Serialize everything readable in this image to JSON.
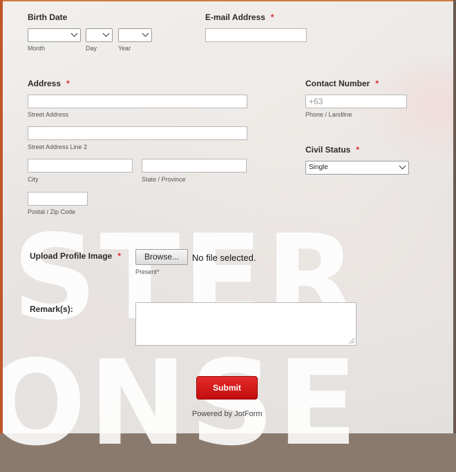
{
  "form": {
    "birth_date": {
      "label": "Birth Date",
      "month_sub": "Month",
      "day_sub": "Day",
      "year_sub": "Year"
    },
    "email": {
      "label": "E-mail Address",
      "required_mark": "*",
      "value": ""
    },
    "address": {
      "label": "Address",
      "required_mark": "*",
      "street_sub": "Street Address",
      "street2_sub": "Street Address Line 2",
      "city_sub": "City",
      "state_sub": "State / Province",
      "zip_sub": "Postal / Zip Code"
    },
    "contact": {
      "label": "Contact Number",
      "required_mark": "*",
      "placeholder": "+63",
      "sub": "Phone / Landline"
    },
    "civil_status": {
      "label": "Civil Status",
      "required_mark": "*",
      "selected": "Single"
    },
    "upload": {
      "label": "Upload Profile Image",
      "required_mark": "*",
      "browse_label": "Browse...",
      "status": "No file selected.",
      "sub": "Present*"
    },
    "remarks": {
      "label": "Remark(s):"
    },
    "submit_label": "Submit",
    "powered_by": "Powered by JotForm"
  },
  "background_text": {
    "line1": "STER",
    "line2": "ONSE"
  },
  "colors": {
    "accent_red": "#e0262b",
    "submit_red": "#d41c1c"
  }
}
